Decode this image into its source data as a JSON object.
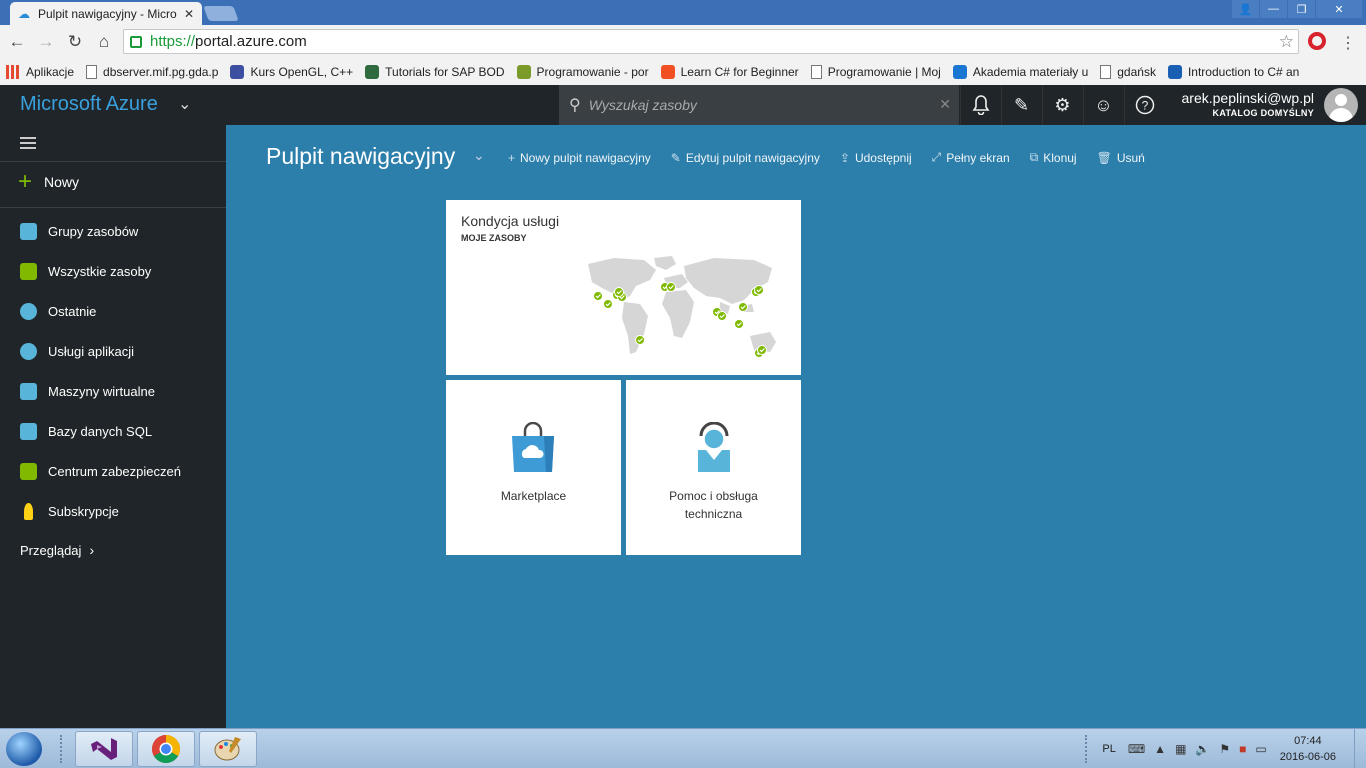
{
  "browser": {
    "tab_title": "Pulpit nawigacyjny - Micro",
    "url_scheme": "https://",
    "url_host": "portal.azure.com",
    "bookmarks": [
      {
        "label": "Aplikacje",
        "icon": "apps-grid-icon",
        "color": "#e34a2f"
      },
      {
        "label": "dbserver.mif.pg.gda.p",
        "icon": "page-icon",
        "color": "#777777"
      },
      {
        "label": "Kurs OpenGL, C++",
        "icon": "gear-bug-icon",
        "color": "#3c4fa0"
      },
      {
        "label": "Tutorials for SAP BOD",
        "icon": "diamond-icon",
        "color": "#2f6b3f"
      },
      {
        "label": "Programowanie - por",
        "icon": "leaf-icon",
        "color": "#7a9a2a"
      },
      {
        "label": "Learn C# for Beginner",
        "icon": "windows-logo-icon",
        "color": "#f25022"
      },
      {
        "label": "Programowanie | Moj",
        "icon": "page-icon",
        "color": "#777777"
      },
      {
        "label": "Akademia materiały u",
        "icon": "onedrive-icon",
        "color": "#1976d2"
      },
      {
        "label": "gdańsk",
        "icon": "page-icon",
        "color": "#777777"
      },
      {
        "label": "Introduction to C# an",
        "icon": "f-logo-icon",
        "color": "#1a5fb4"
      }
    ]
  },
  "azure": {
    "brand": "Microsoft Azure",
    "search_placeholder": "Wyszukaj zasoby",
    "user_email": "arek.peplinski@wp.pl",
    "user_directory": "KATALOG DOMYŚLNY",
    "accent": "#3aa0dd"
  },
  "sidebar": {
    "new_label": "Nowy",
    "items": [
      {
        "label": "Grupy zasobów",
        "icon": "resource-group-icon",
        "color": "#59b4d9"
      },
      {
        "label": "Wszystkie zasoby",
        "icon": "grid-icon",
        "color": "#7fba00"
      },
      {
        "label": "Ostatnie",
        "icon": "clock-icon",
        "color": "#59b4d9"
      },
      {
        "label": "Usługi aplikacji",
        "icon": "globe-icon",
        "color": "#59b4d9"
      },
      {
        "label": "Maszyny wirtualne",
        "icon": "monitor-icon",
        "color": "#59b4d9"
      },
      {
        "label": "Bazy danych SQL",
        "icon": "sql-database-icon",
        "color": "#59b4d9"
      },
      {
        "label": "Centrum zabezpieczeń",
        "icon": "shield-lock-icon",
        "color": "#7fba00"
      },
      {
        "label": "Subskrypcje",
        "icon": "key-icon",
        "color": "#fcd116"
      }
    ],
    "browse_label": "Przeglądaj"
  },
  "dashboard": {
    "title": "Pulpit nawigacyjny",
    "commands": [
      {
        "label": "Nowy pulpit nawigacyjny",
        "icon": "plus-icon"
      },
      {
        "label": "Edytuj pulpit nawigacyjny",
        "icon": "pencil-icon"
      },
      {
        "label": "Udostępnij",
        "icon": "share-icon"
      },
      {
        "label": "Pełny ekran",
        "icon": "fullscreen-icon"
      },
      {
        "label": "Klonuj",
        "icon": "clone-icon"
      },
      {
        "label": "Usuń",
        "icon": "trash-icon"
      }
    ],
    "tiles": {
      "health_title": "Kondycja usługi",
      "health_subtitle": "MOJE ZASOBY",
      "marketplace": "Marketplace",
      "help_line1": "Pomoc i obsługa",
      "help_line2": "techniczna"
    }
  },
  "taskbar": {
    "lang": "PL",
    "time": "07:44",
    "date": "2016-06-06"
  }
}
